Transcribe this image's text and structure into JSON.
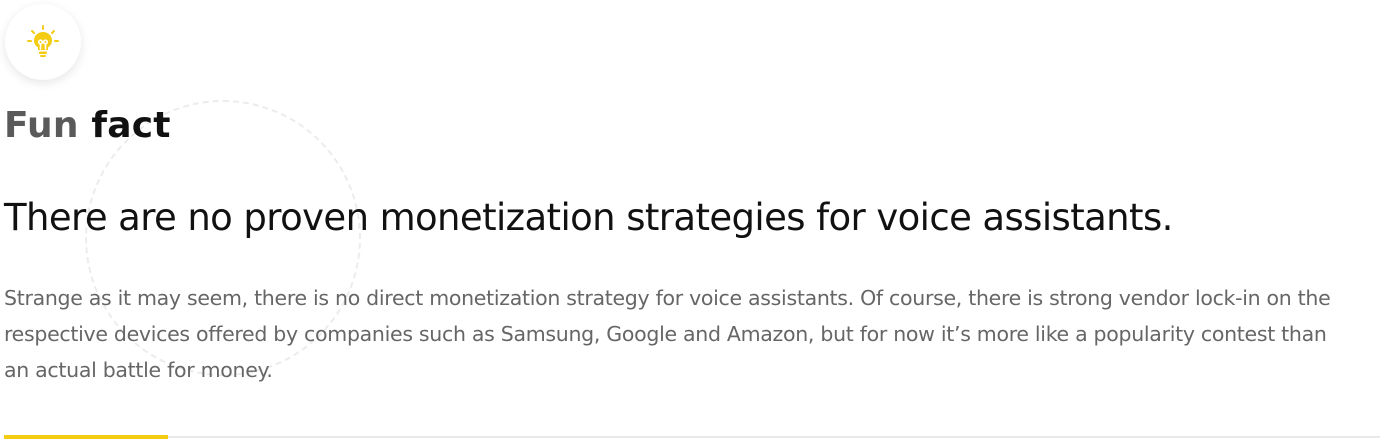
{
  "icon": {
    "name": "lightbulb-icon",
    "color": "#f4cc14"
  },
  "section": {
    "title_light": "Fun",
    "title_dark": "fact"
  },
  "headline": "There are no proven monetization strategies for voice assistants.",
  "body": "Strange as it may seem, there is no direct monetization strategy for voice assistants. Of course, there is strong vendor lock-in on the respective devices offered by companies such as Samsung, Google and Amazon, but for now it’s more like a popularity contest than an actual battle for money.",
  "colors": {
    "accent": "#f4cc14",
    "title_light": "#5a5a5a",
    "text": "#111111",
    "body": "#666666"
  }
}
